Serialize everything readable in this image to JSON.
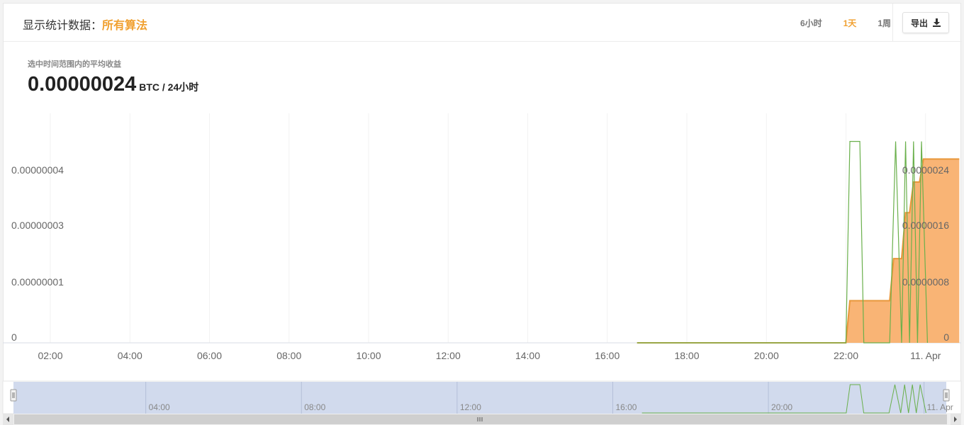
{
  "header": {
    "title_label": "显示统计数据：",
    "algorithm": "所有算法",
    "ranges": [
      "6小时",
      "1天",
      "1周"
    ],
    "active_range": "1天",
    "export_label": "导出"
  },
  "stat": {
    "label": "选中时间范围内的平均收益",
    "value": "0.00000024",
    "unit": "BTC / 24小时"
  },
  "chart_data": {
    "type": "area",
    "x_tick_labels": [
      "02:00",
      "04:00",
      "06:00",
      "08:00",
      "10:00",
      "12:00",
      "14:00",
      "16:00",
      "18:00",
      "20:00",
      "22:00",
      "11. Apr"
    ],
    "y_left_ticks": [
      "0",
      "0.00000001",
      "0.00000003",
      "0.00000004"
    ],
    "y_right_ticks": [
      "0",
      "0.0000008",
      "0.0000016",
      "0.0000024"
    ],
    "series": [
      {
        "color": "#f0a040",
        "axis": "right",
        "style": "step-area",
        "points": [
          [
            16.75,
            0
          ],
          [
            22.0,
            0
          ],
          [
            22.1,
            5.5e-07
          ],
          [
            22.85,
            5.5e-07
          ],
          [
            23.1,
            5.5e-07
          ],
          [
            23.2,
            1.1e-06
          ],
          [
            23.4,
            1.1e-06
          ],
          [
            23.5,
            1.7e-06
          ],
          [
            23.6,
            1.7e-06
          ],
          [
            23.7,
            2.1e-06
          ],
          [
            23.85,
            2.1e-06
          ],
          [
            23.95,
            2.4e-06
          ],
          [
            24.85,
            2.4e-06
          ]
        ]
      },
      {
        "color": "#6ab04c",
        "axis": "left",
        "style": "line",
        "points": [
          [
            16.75,
            0
          ],
          [
            17.5,
            0
          ],
          [
            22.0,
            0
          ],
          [
            22.1,
            3.6e-08
          ],
          [
            22.35,
            3.6e-08
          ],
          [
            22.45,
            0
          ],
          [
            23.1,
            0
          ],
          [
            23.25,
            3.6e-08
          ],
          [
            23.4,
            0
          ],
          [
            23.5,
            3.6e-08
          ],
          [
            23.6,
            0
          ],
          [
            23.7,
            3.6e-08
          ],
          [
            23.8,
            0
          ],
          [
            23.9,
            3.6e-08
          ],
          [
            24.05,
            0
          ]
        ]
      }
    ],
    "navigator": {
      "tick_labels": [
        "04:00",
        "08:00",
        "12:00",
        "16:00",
        "20:00",
        "11. Apr"
      ]
    }
  }
}
